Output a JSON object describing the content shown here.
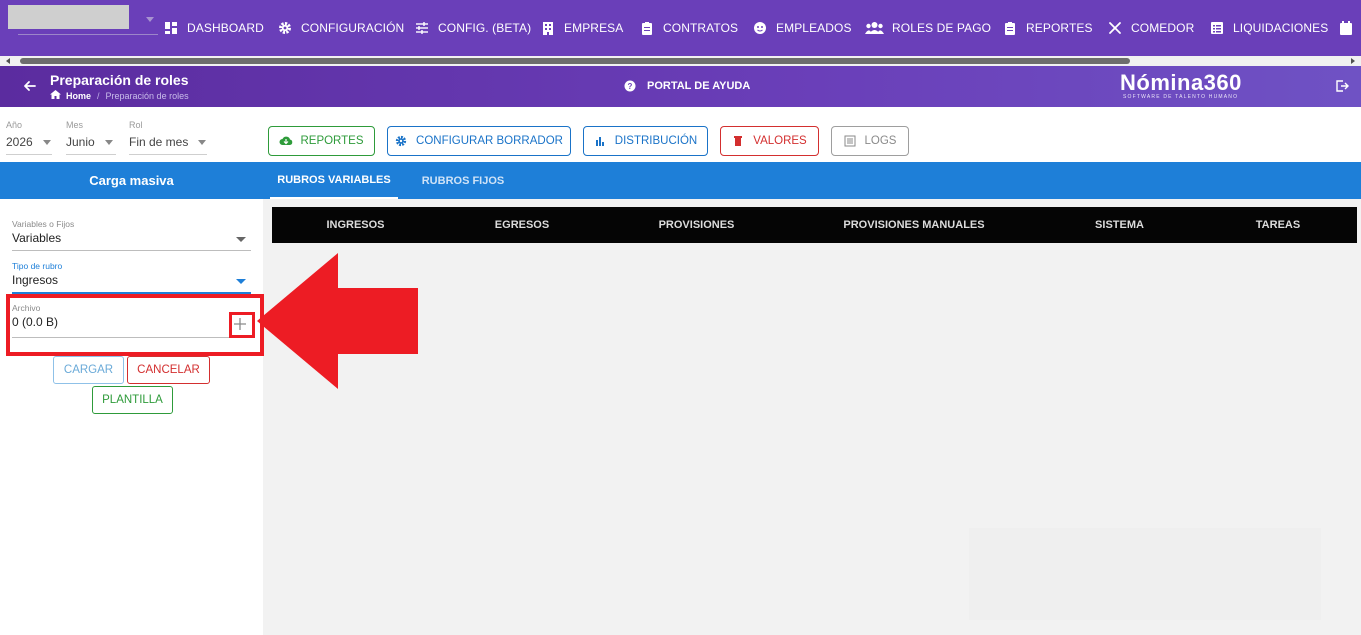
{
  "topnav": {
    "items": [
      {
        "label": "DASHBOARD",
        "icon": "dashboard-icon"
      },
      {
        "label": "CONFIGURACIÓN",
        "icon": "gear-icon"
      },
      {
        "label": "CONFIG. (BETA)",
        "icon": "sliders-icon"
      },
      {
        "label": "EMPRESA",
        "icon": "building-icon"
      },
      {
        "label": "CONTRATOS",
        "icon": "clipboard-icon"
      },
      {
        "label": "EMPLEADOS",
        "icon": "face-icon"
      },
      {
        "label": "ROLES DE PAGO",
        "icon": "users-icon"
      },
      {
        "label": "REPORTES",
        "icon": "clipboard-icon"
      },
      {
        "label": "COMEDOR",
        "icon": "utensils-icon"
      },
      {
        "label": "LIQUIDACIONES",
        "icon": "list-icon"
      }
    ]
  },
  "header": {
    "title": "Preparación de roles",
    "breadcrumb_home": "Home",
    "breadcrumb_sep": "/",
    "breadcrumb_current": "Preparación de roles",
    "help_label": "PORTAL DE AYUDA",
    "brand_name": "Nómina360",
    "brand_tagline": "SOFTWARE DE TALENTO HUMANO"
  },
  "filters": {
    "year_label": "Año",
    "year_value": "2026",
    "month_label": "Mes",
    "month_value": "Junio",
    "rol_label": "Rol",
    "rol_value": "Fin de mes"
  },
  "actions": {
    "reportes": "REPORTES",
    "configurar": "CONFIGURAR BORRADOR",
    "distribucion": "DISTRIBUCIÓN",
    "valores": "VALORES",
    "logs": "LOGS"
  },
  "left": {
    "title": "Carga masiva",
    "var_fijos_label": "Variables o Fijos",
    "var_fijos_value": "Variables",
    "tipo_label": "Tipo de rubro",
    "tipo_value": "Ingresos",
    "archivo_label": "Archivo",
    "archivo_value": "0 (0.0 B)",
    "cargar": "CARGAR",
    "cancelar": "CANCELAR",
    "plantilla": "PLANTILLA"
  },
  "tabs": {
    "variables": "RUBROS VARIABLES",
    "fijos": "RUBROS FIJOS"
  },
  "subtabs": [
    "INGRESOS",
    "EGRESOS",
    "PROVISIONES",
    "PROVISIONES MANUALES",
    "SISTEMA",
    "TAREAS"
  ],
  "colors": {
    "nav": "#6a3fb9",
    "primary": "#1e7fd8",
    "annotation": "#ed1c24"
  }
}
